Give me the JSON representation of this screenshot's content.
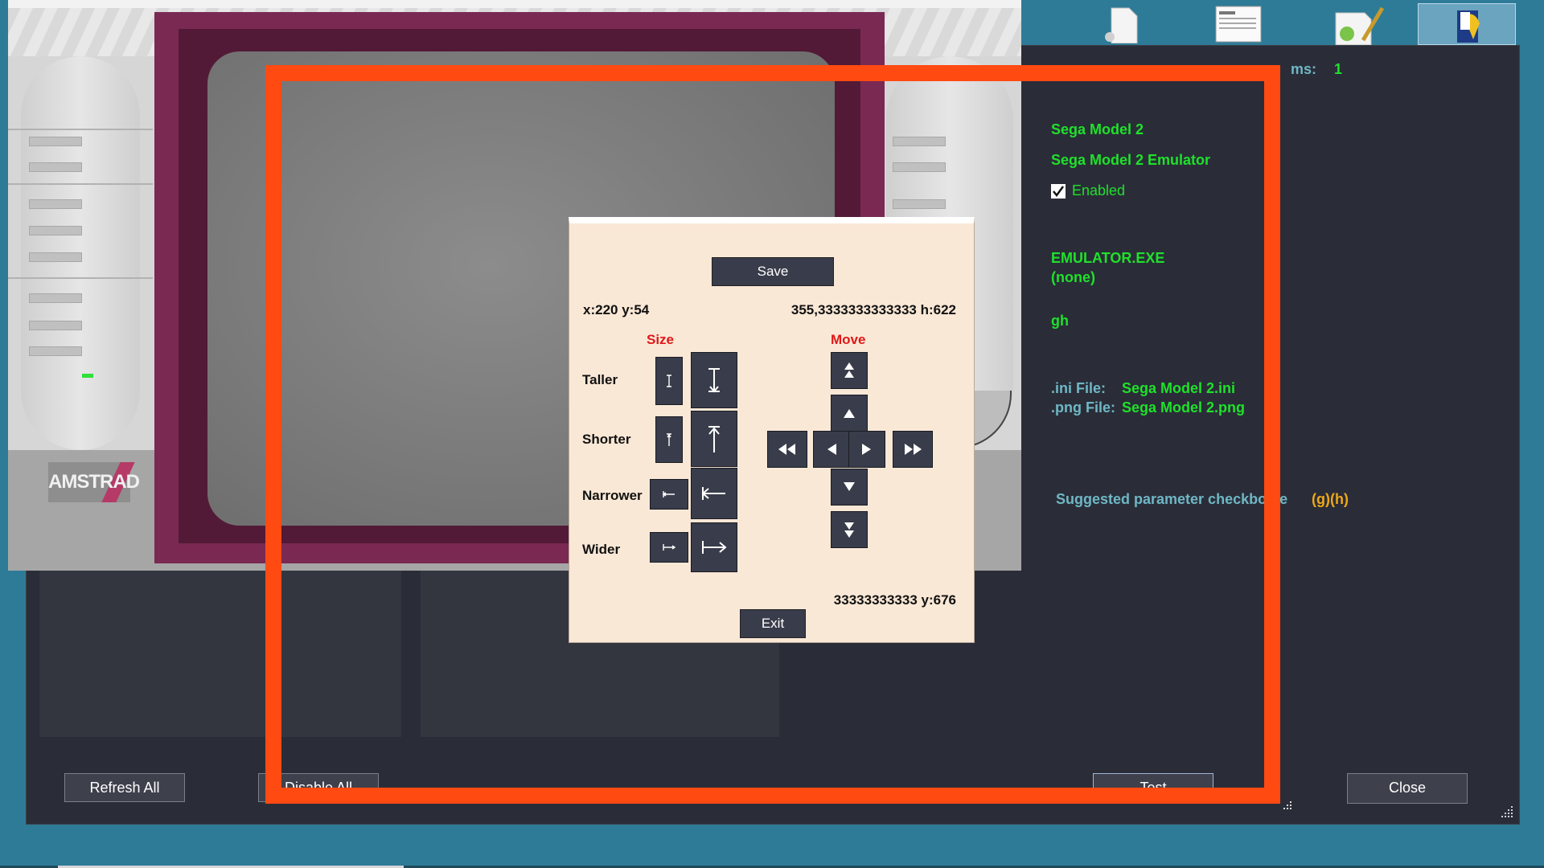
{
  "app": {
    "header_partial": "ms:",
    "header_count": "1",
    "platform": "Sega Model 2",
    "emulator": "Sega Model 2 Emulator",
    "enabled_label": "Enabled",
    "enabled_checked": true,
    "exe": "EMULATOR.EXE",
    "none": "(none)",
    "gh": "gh",
    "ini_label": ".ini File:",
    "ini_value": "Sega Model 2.ini",
    "png_label": ".png File:",
    "png_value": "Sega Model 2.png",
    "suggested_label": "Suggested parameter checkbox(e",
    "suggested_value": "(g)(h)",
    "refresh_all": "Refresh All",
    "disable_all": "Disable All",
    "test": "Test",
    "close": "Close"
  },
  "preview": {
    "logo_text": "AMSTRAD"
  },
  "dialog": {
    "save": "Save",
    "coords_top": "x:220 y:54",
    "size_top": "355,3333333333333 h:622",
    "size_heading": "Size",
    "move_heading": "Move",
    "taller": "Taller",
    "shorter": "Shorter",
    "narrower": "Narrower",
    "wider": "Wider",
    "coords_bottom": "33333333333 y:676",
    "exit": "Exit"
  },
  "colors": {
    "desktop": "#2e7b98",
    "app_bg": "#2a2d38",
    "accent_green": "#1fe12a",
    "highlight": "#ff4a12",
    "dialog_bg": "#fae8d6",
    "dialog_button": "#393c4a",
    "size_move_red": "#e01818"
  },
  "icons": [
    "file-icon",
    "document-icon",
    "notepad-icon",
    "folder-icon",
    "checkbox-icon",
    "resize-grip-icon"
  ]
}
